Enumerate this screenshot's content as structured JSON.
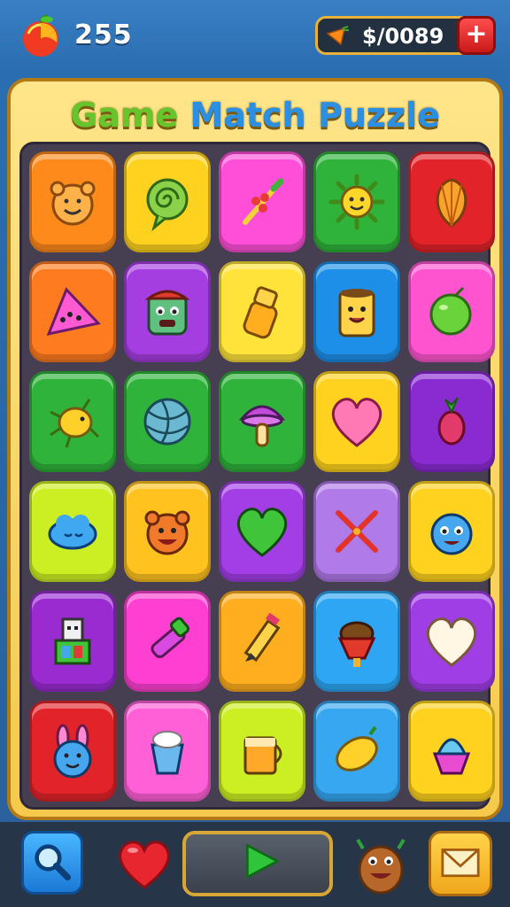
{
  "header": {
    "score_value": "255",
    "currency_value": "$/0089",
    "add_button_label": "+",
    "icons": [
      "fruit-icon",
      "carrot-coin-icon"
    ]
  },
  "board": {
    "title_words": [
      "Game",
      "Match",
      "Puzzle"
    ],
    "rows": 6,
    "cols": 5,
    "tiles": [
      {
        "color": "#ff8a1c",
        "icon": "teddy-face-icon"
      },
      {
        "color": "#ffd21f",
        "icon": "lollipop-spiral-icon"
      },
      {
        "color": "#ff4fd8",
        "icon": "wand-icon"
      },
      {
        "color": "#2fb33a",
        "icon": "sun-face-icon"
      },
      {
        "color": "#e2242a",
        "icon": "shell-icon"
      },
      {
        "color": "#ff7b1f",
        "icon": "triangle-monster-icon"
      },
      {
        "color": "#a53ee0",
        "icon": "robot-face-icon"
      },
      {
        "color": "#ffe23a",
        "icon": "salt-shaker-icon"
      },
      {
        "color": "#1e8fe8",
        "icon": "can-face-icon"
      },
      {
        "color": "#ff54d0",
        "icon": "apple-icon"
      },
      {
        "color": "#2fb33a",
        "icon": "bug-icon"
      },
      {
        "color": "#2fb33a",
        "icon": "ball-icon"
      },
      {
        "color": "#2fb33a",
        "icon": "mushroom-icon"
      },
      {
        "color": "#ffd21f",
        "icon": "heart-icon"
      },
      {
        "color": "#8a2bd1",
        "icon": "berry-icon"
      },
      {
        "color": "#ccef23",
        "icon": "cloud-face-icon"
      },
      {
        "color": "#ffc21f",
        "icon": "bear-face-icon"
      },
      {
        "color": "#a33ee6",
        "icon": "green-heart-icon"
      },
      {
        "color": "#b07ae8",
        "icon": "crossed-tools-icon"
      },
      {
        "color": "#ffd21f",
        "icon": "blue-monster-icon"
      },
      {
        "color": "#9a2bd1",
        "icon": "toy-block-icon"
      },
      {
        "color": "#ff3fd2",
        "icon": "lipstick-icon"
      },
      {
        "color": "#ffae1f",
        "icon": "pencil-icon"
      },
      {
        "color": "#2ea6f3",
        "icon": "acorn-cup-icon"
      },
      {
        "color": "#a03ee6",
        "icon": "white-heart-icon"
      },
      {
        "color": "#e2242a",
        "icon": "bunny-face-icon"
      },
      {
        "color": "#ff5fd7",
        "icon": "sundae-cup-icon"
      },
      {
        "color": "#ccef23",
        "icon": "juice-glass-icon"
      },
      {
        "color": "#36a7f0",
        "icon": "lemon-icon"
      },
      {
        "color": "#ffd21f",
        "icon": "cupcake-icon"
      }
    ]
  },
  "footer": {
    "buttons": [
      "search-button",
      "heart-button",
      "play-button",
      "monster-button",
      "mail-button"
    ]
  }
}
